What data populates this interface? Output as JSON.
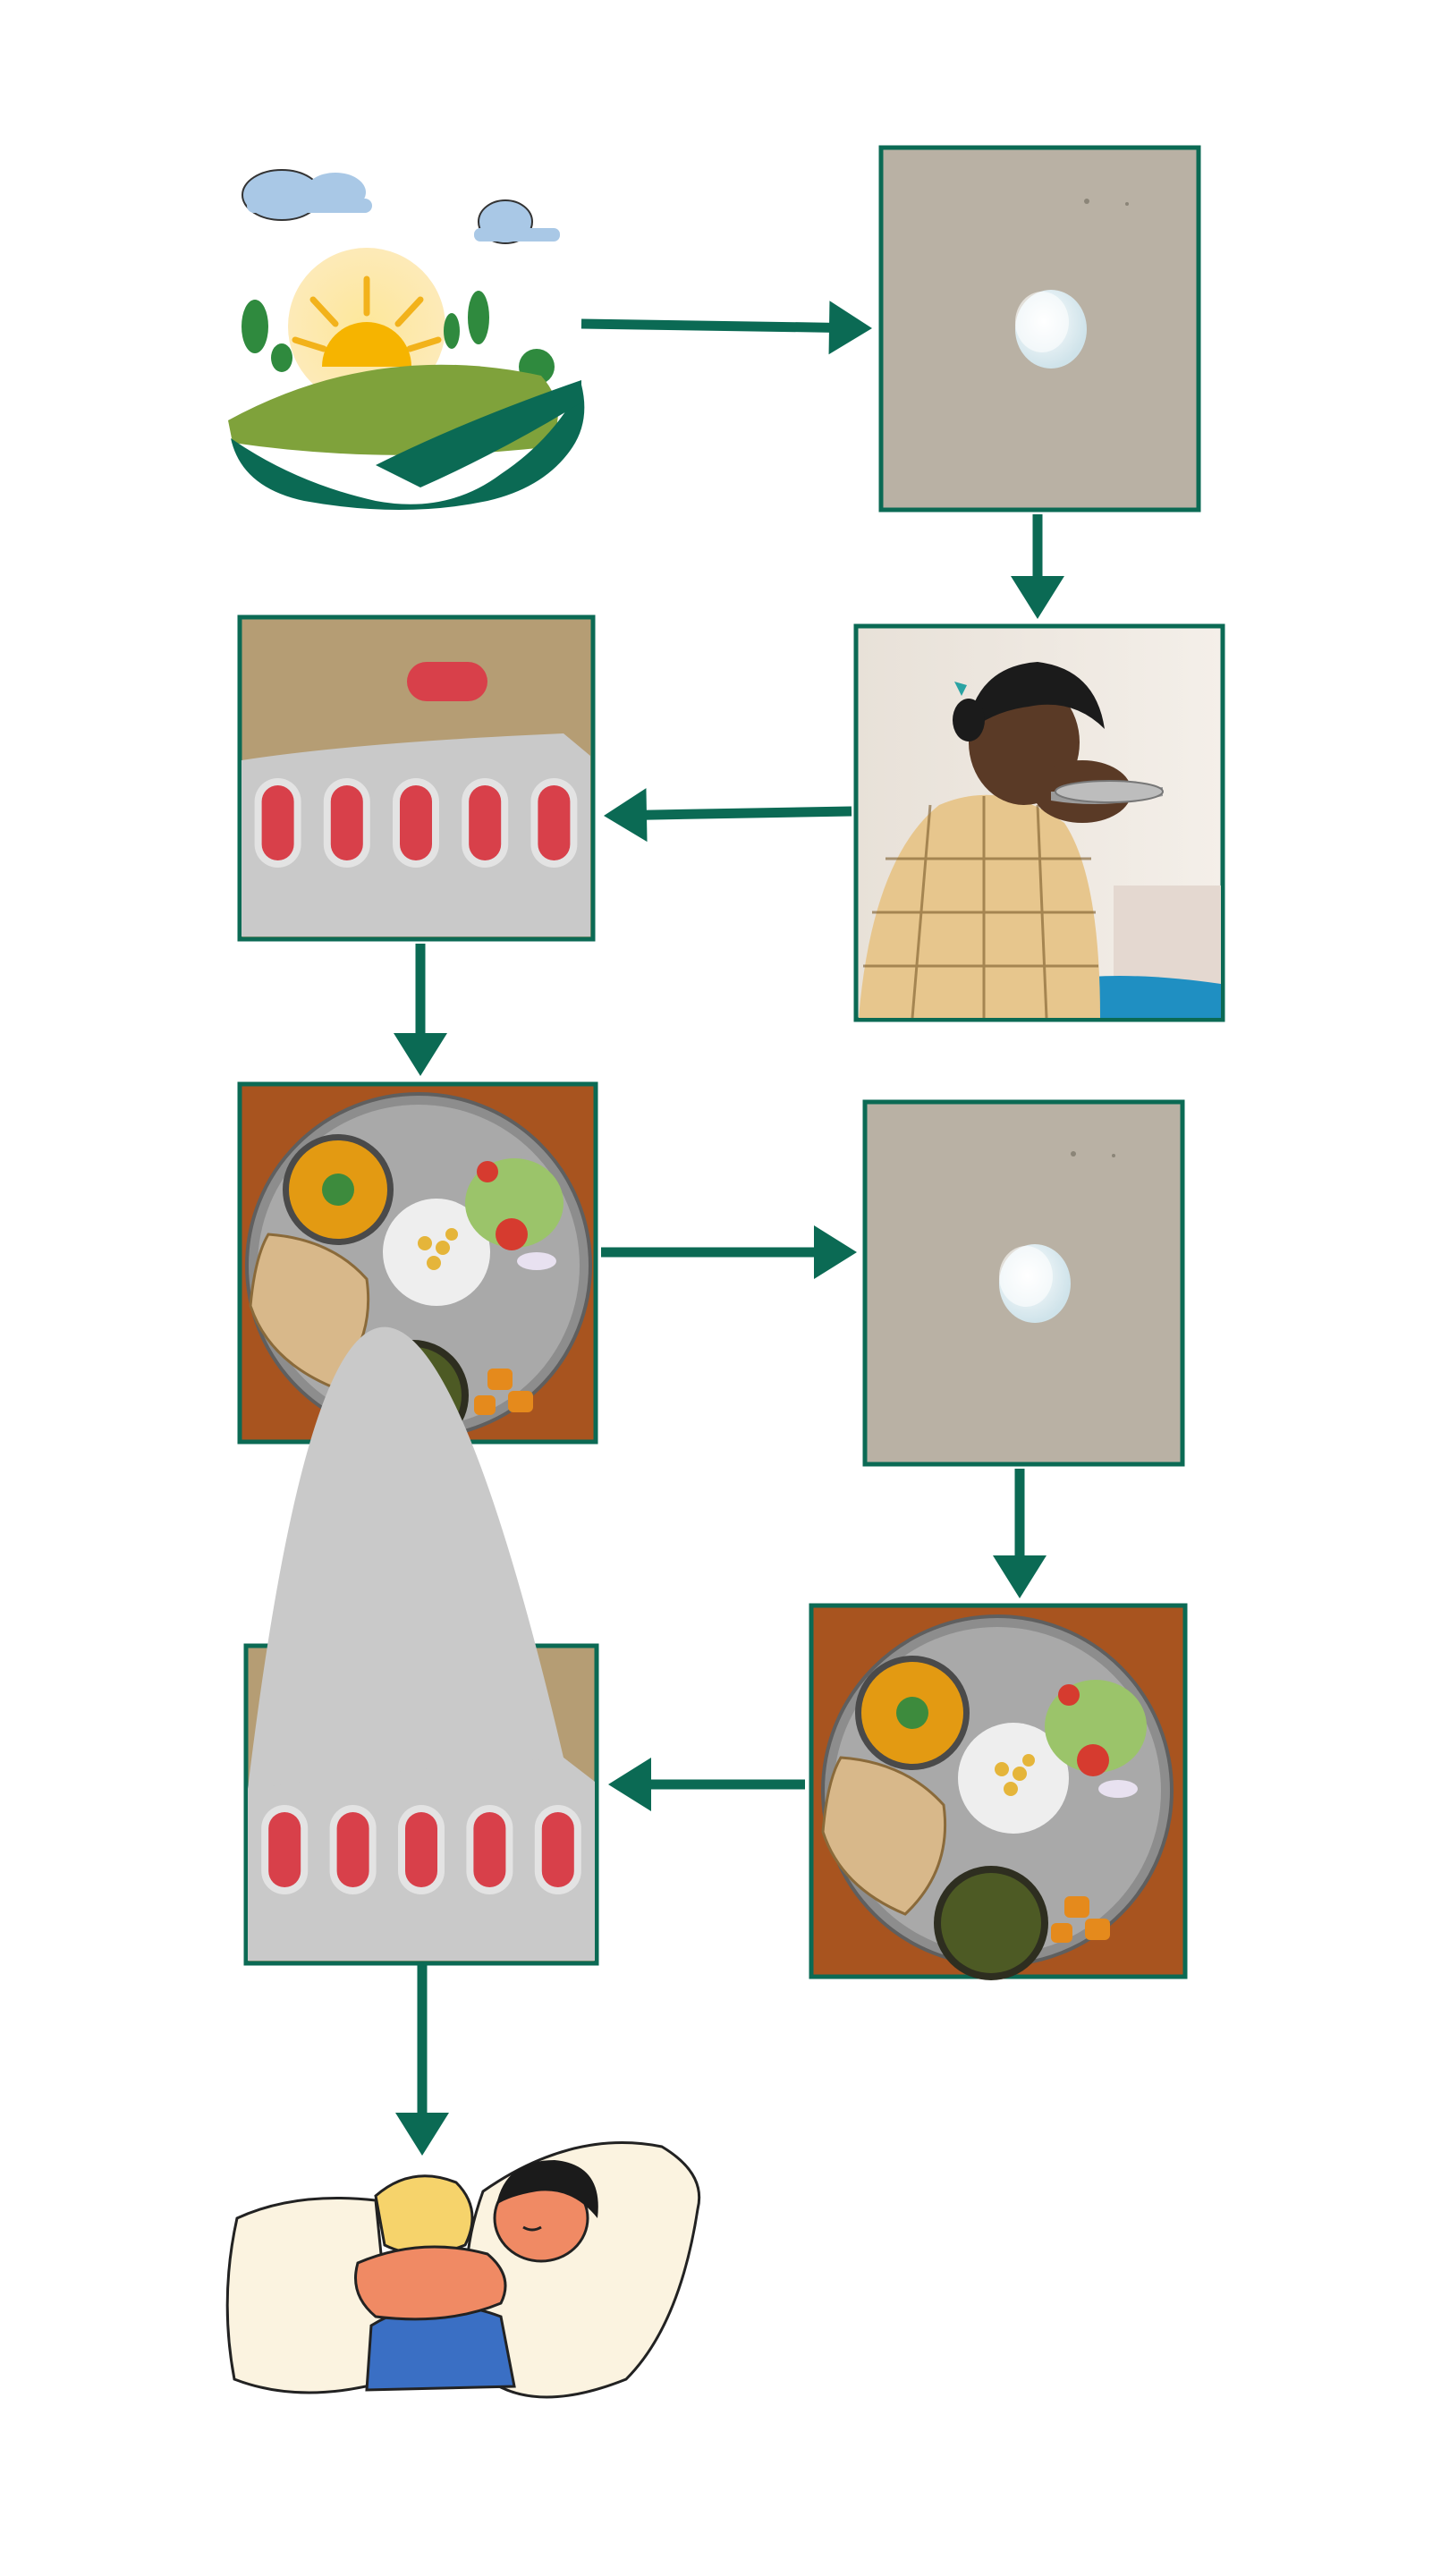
{
  "diagram": {
    "type": "flow",
    "colors": {
      "arrow": "#0b6a54",
      "frame": "#0b6a54",
      "background": "#ffffff",
      "paper": "#b8b0a3",
      "blister": "#c9c9c9",
      "pill_red": "#d8404a",
      "wood": "#a8541f",
      "plate": "#8d8d8d"
    },
    "steps": [
      {
        "id": "sunrise",
        "icon": "sunrise-illustration"
      },
      {
        "id": "white-tablet-1",
        "icon": "white-tablet-photo"
      },
      {
        "id": "woman-drinking",
        "icon": "woman-drinking-photo"
      },
      {
        "id": "red-pills-1",
        "icon": "red-pill-blister-photo"
      },
      {
        "id": "meal-1",
        "icon": "meal-thali-photo"
      },
      {
        "id": "white-tablet-2",
        "icon": "white-tablet-photo"
      },
      {
        "id": "meal-2",
        "icon": "meal-thali-photo"
      },
      {
        "id": "red-pills-2",
        "icon": "red-pill-blister-photo"
      },
      {
        "id": "sleeping",
        "icon": "sleeping-person-illustration"
      }
    ],
    "connections": [
      {
        "from": "sunrise",
        "to": "white-tablet-1",
        "direction": "right"
      },
      {
        "from": "white-tablet-1",
        "to": "woman-drinking",
        "direction": "down"
      },
      {
        "from": "woman-drinking",
        "to": "red-pills-1",
        "direction": "left"
      },
      {
        "from": "red-pills-1",
        "to": "meal-1",
        "direction": "down"
      },
      {
        "from": "meal-1",
        "to": "white-tablet-2",
        "direction": "right"
      },
      {
        "from": "white-tablet-2",
        "to": "meal-2",
        "direction": "down"
      },
      {
        "from": "meal-2",
        "to": "red-pills-2",
        "direction": "left"
      },
      {
        "from": "red-pills-2",
        "to": "sleeping",
        "direction": "down"
      }
    ]
  }
}
